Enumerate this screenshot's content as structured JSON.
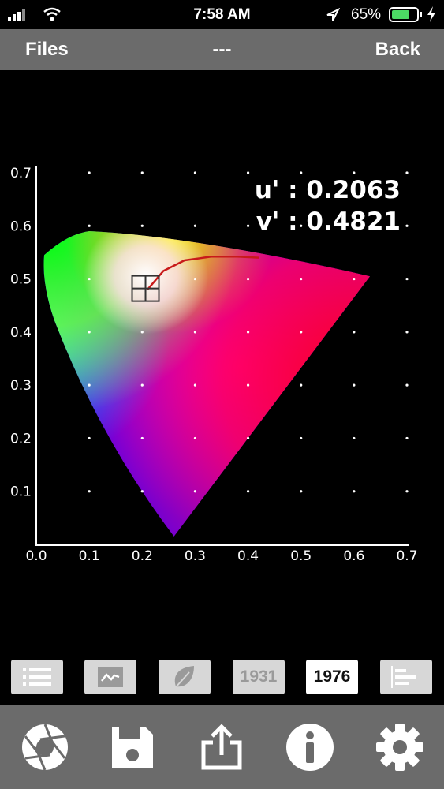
{
  "status_bar": {
    "time": "7:58 AM",
    "battery": "65%"
  },
  "nav": {
    "left": "Files",
    "title": "---",
    "right": "Back"
  },
  "readout": {
    "u_text": "u' : 0.2063",
    "v_text": "v' : 0.4821"
  },
  "chart_data": {
    "type": "scatter",
    "title": "",
    "xlabel": "",
    "ylabel": "",
    "xlim": [
      0.0,
      0.7
    ],
    "ylim": [
      0.0,
      0.7
    ],
    "x_ticks": [
      "0.0",
      "0.1",
      "0.2",
      "0.3",
      "0.4",
      "0.5",
      "0.6",
      "0.7"
    ],
    "y_ticks": [
      "0.1",
      "0.2",
      "0.3",
      "0.4",
      "0.5",
      "0.6",
      "0.7"
    ],
    "grid": "dots",
    "point": {
      "u": 0.2063,
      "v": 0.4821
    },
    "gamut_corners": [
      {
        "name": "red",
        "u": 0.63,
        "v": 0.505
      },
      {
        "name": "green",
        "u": 0.06,
        "v": 0.585
      },
      {
        "name": "blue",
        "u": 0.26,
        "v": 0.015
      }
    ],
    "planckian_locus": [
      [
        0.21,
        0.48
      ],
      [
        0.24,
        0.515
      ],
      [
        0.28,
        0.535
      ],
      [
        0.33,
        0.542
      ],
      [
        0.38,
        0.542
      ],
      [
        0.42,
        0.54
      ]
    ]
  },
  "tabs": [
    {
      "name": "list",
      "icon": "list-icon",
      "label": ""
    },
    {
      "name": "graph",
      "icon": "line-graph-icon",
      "label": ""
    },
    {
      "name": "leaf",
      "icon": "leaf-icon",
      "label": ""
    },
    {
      "name": "cie1931",
      "icon": "",
      "label": "1931"
    },
    {
      "name": "cie1976",
      "icon": "",
      "label": "1976",
      "active": true
    },
    {
      "name": "histogram",
      "icon": "bar-chart-icon",
      "label": ""
    }
  ],
  "toolbar": [
    "aperture-icon",
    "save-icon",
    "share-icon",
    "info-icon",
    "gear-icon"
  ]
}
